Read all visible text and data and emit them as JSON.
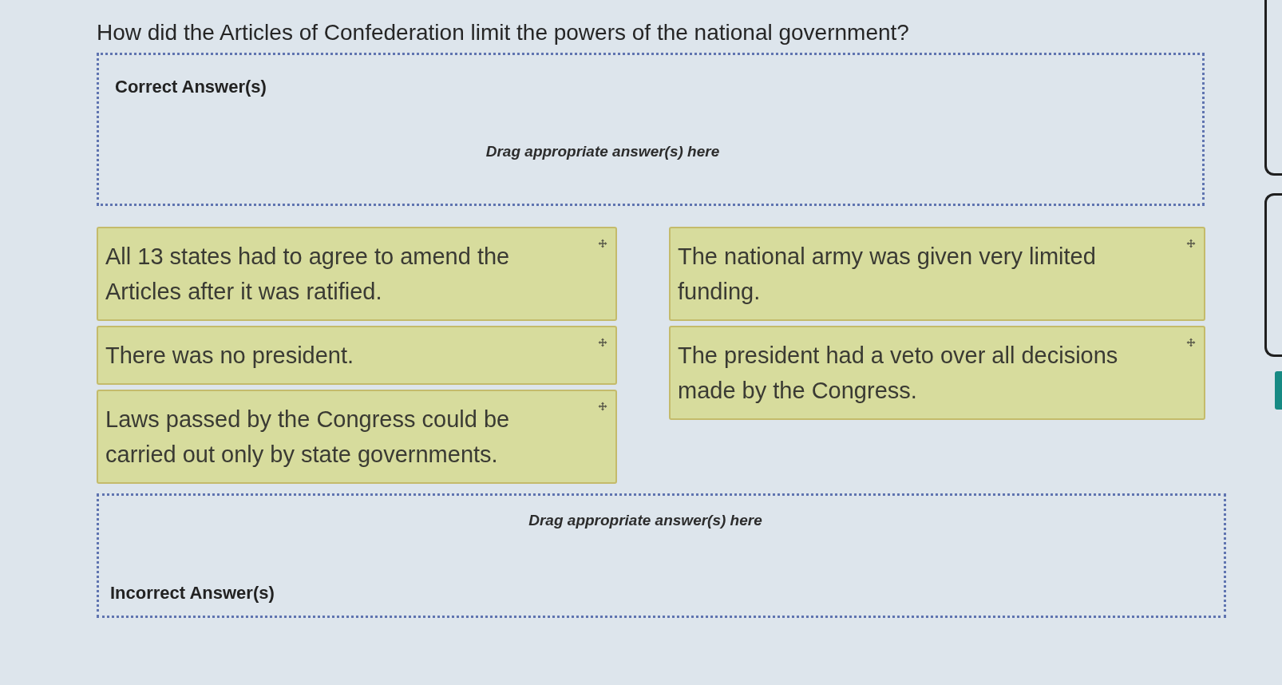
{
  "question": "How did the Articles of Confederation limit the powers of the national government?",
  "zones": [
    {
      "kind": "correct",
      "label": "Correct Answer(s)",
      "hint": "Drag appropriate answer(s) here"
    },
    {
      "kind": "incorrect",
      "label": "Incorrect Answer(s)",
      "hint": "Drag appropriate answer(s) here"
    }
  ],
  "answer_bank": {
    "columns": [
      [
        "All 13 states had to agree to amend the Articles after it was ratified.",
        "There was no president.",
        "Laws passed by the Congress could be carried out only by state governments."
      ],
      [
        "The national army was given very limited funding.",
        "The president had a veto over all decisions made by the Congress."
      ]
    ]
  }
}
